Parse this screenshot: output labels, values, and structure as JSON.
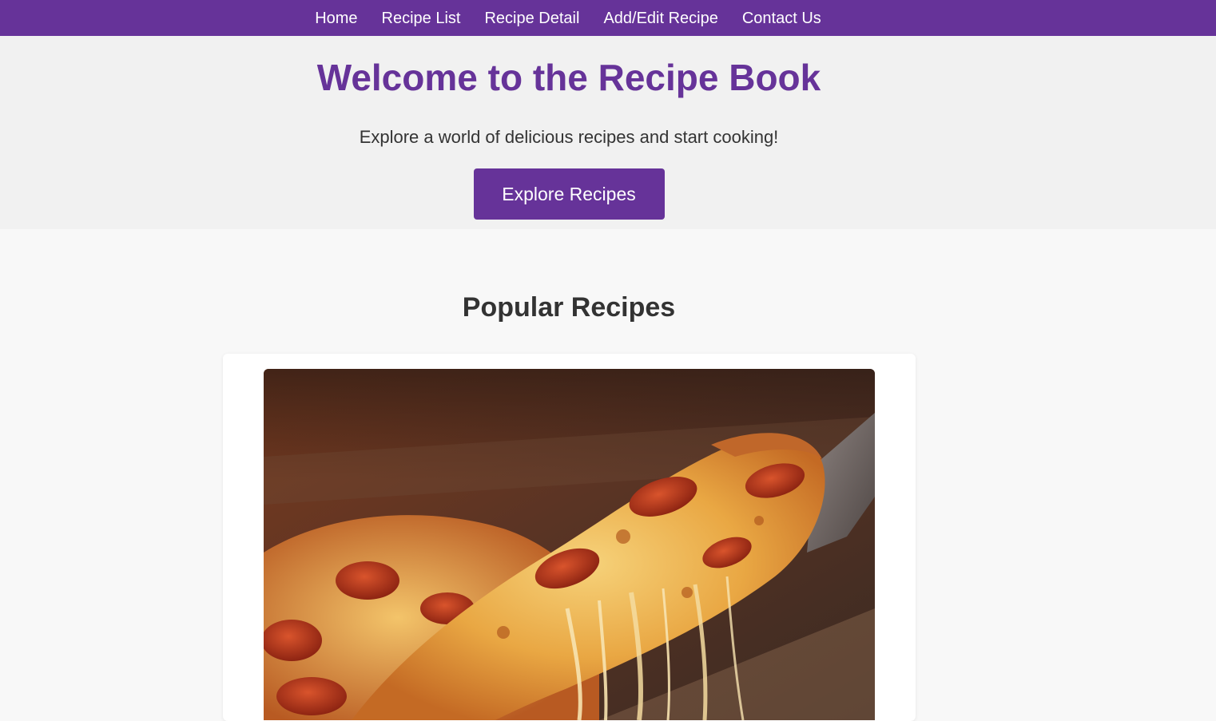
{
  "nav": {
    "items": [
      {
        "label": "Home"
      },
      {
        "label": "Recipe List"
      },
      {
        "label": "Recipe Detail"
      },
      {
        "label": "Add/Edit Recipe"
      },
      {
        "label": "Contact Us"
      }
    ]
  },
  "hero": {
    "title": "Welcome to the Recipe Book",
    "subtitle": "Explore a world of delicious recipes and start cooking!",
    "button_label": "Explore Recipes"
  },
  "popular": {
    "title": "Popular Recipes",
    "cards": [
      {
        "image": "pepperoni-pizza-photo"
      }
    ]
  },
  "colors": {
    "brand": "#663399",
    "hero_bg": "#f1f1f1",
    "page_bg": "#f8f8f8",
    "card_bg": "#ffffff"
  }
}
